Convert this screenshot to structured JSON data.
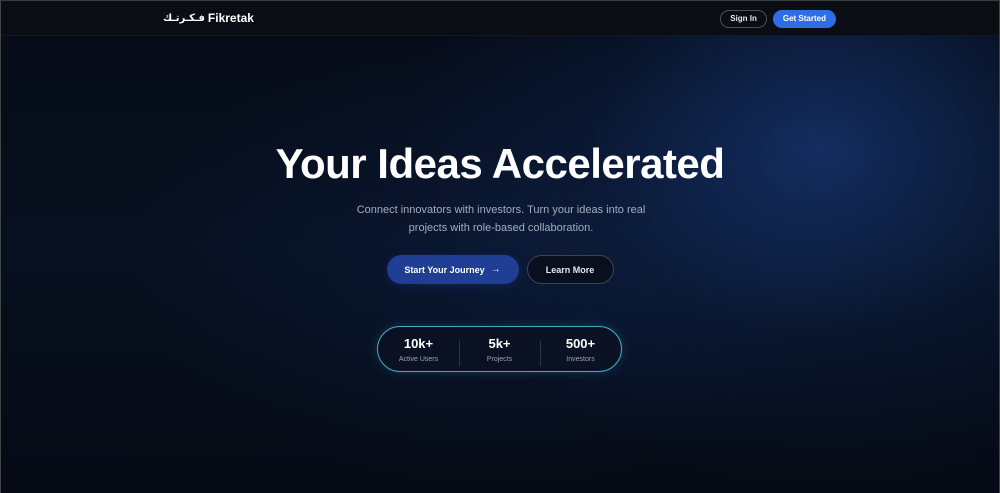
{
  "nav": {
    "brand_arabic": "فـكـرتـك",
    "brand_name": "Fikretak",
    "signin_label": "Sign In",
    "getstarted_label": "Get Started"
  },
  "hero": {
    "title": "Your Ideas Accelerated",
    "subtitle_line1": "Connect innovators with investors. Turn your ideas into real",
    "subtitle_line2": "projects with role-based collaboration.",
    "primary_cta": "Start Your Journey",
    "primary_cta_arrow": "→",
    "secondary_cta": "Learn More"
  },
  "stats": [
    {
      "value": "10k+",
      "label": "Active Users"
    },
    {
      "value": "5k+",
      "label": "Projects"
    },
    {
      "value": "500+",
      "label": "Investors"
    }
  ],
  "colors": {
    "accent": "#2f6de6",
    "primary_cta_bg": "#1f3e94",
    "stats_border": "#4aa8c7",
    "background": "#060b17"
  }
}
